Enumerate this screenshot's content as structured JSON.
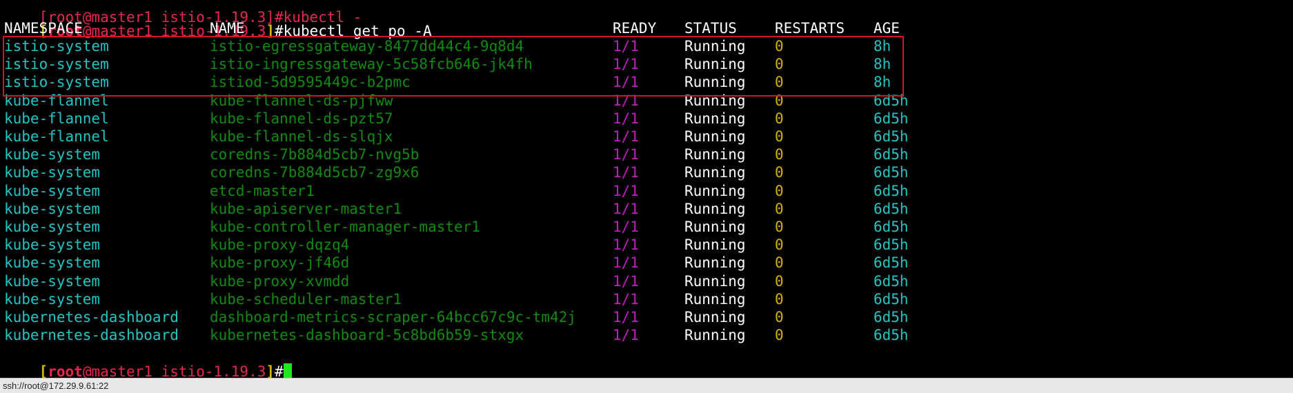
{
  "prompt": {
    "open_bracket": "[",
    "user": "root",
    "at": "@",
    "host": "master1",
    "dir": "istio-1.19.3",
    "close_bracket": "]",
    "hash": "#"
  },
  "top_partial_line": "[root@master1 istio-1.19.3]#kubectl -",
  "command": "kubectl get po -A",
  "table": {
    "headers": [
      "NAMESPACE",
      "NAME",
      "READY",
      "STATUS",
      "RESTARTS",
      "AGE"
    ],
    "rows": [
      [
        "istio-system",
        "istio-egressgateway-8477dd44c4-9q8d4",
        "1/1",
        "Running",
        "0",
        "8h"
      ],
      [
        "istio-system",
        "istio-ingressgateway-5c58fcb646-jk4fh",
        "1/1",
        "Running",
        "0",
        "8h"
      ],
      [
        "istio-system",
        "istiod-5d9595449c-b2pmc",
        "1/1",
        "Running",
        "0",
        "8h"
      ],
      [
        "kube-flannel",
        "kube-flannel-ds-pjfww",
        "1/1",
        "Running",
        "0",
        "6d5h"
      ],
      [
        "kube-flannel",
        "kube-flannel-ds-pzt57",
        "1/1",
        "Running",
        "0",
        "6d5h"
      ],
      [
        "kube-flannel",
        "kube-flannel-ds-slqjx",
        "1/1",
        "Running",
        "0",
        "6d5h"
      ],
      [
        "kube-system",
        "coredns-7b884d5cb7-nvg5b",
        "1/1",
        "Running",
        "0",
        "6d5h"
      ],
      [
        "kube-system",
        "coredns-7b884d5cb7-zg9x6",
        "1/1",
        "Running",
        "0",
        "6d5h"
      ],
      [
        "kube-system",
        "etcd-master1",
        "1/1",
        "Running",
        "0",
        "6d5h"
      ],
      [
        "kube-system",
        "kube-apiserver-master1",
        "1/1",
        "Running",
        "0",
        "6d5h"
      ],
      [
        "kube-system",
        "kube-controller-manager-master1",
        "1/1",
        "Running",
        "0",
        "6d5h"
      ],
      [
        "kube-system",
        "kube-proxy-dqzq4",
        "1/1",
        "Running",
        "0",
        "6d5h"
      ],
      [
        "kube-system",
        "kube-proxy-jf46d",
        "1/1",
        "Running",
        "0",
        "6d5h"
      ],
      [
        "kube-system",
        "kube-proxy-xvmdd",
        "1/1",
        "Running",
        "0",
        "6d5h"
      ],
      [
        "kube-system",
        "kube-scheduler-master1",
        "1/1",
        "Running",
        "0",
        "6d5h"
      ],
      [
        "kubernetes-dashboard",
        "dashboard-metrics-scraper-64bcc67c9c-tm42j",
        "1/1",
        "Running",
        "0",
        "6d5h"
      ],
      [
        "kubernetes-dashboard",
        "kubernetes-dashboard-5c8bd6b59-stxgx",
        "1/1",
        "Running",
        "0",
        "6d5h"
      ]
    ]
  },
  "statusbar": {
    "connection": "ssh://root@172.29.9.61:22"
  },
  "colors": {
    "background": "#000000",
    "namespace": "#22c4c4",
    "name": "#118a11",
    "ready": "#c21bc2",
    "restarts": "#d4b200",
    "age": "#22c4c4",
    "prompt_host": "#e8264e",
    "cursor": "#1ee81e",
    "highlight_box": "#d8141e"
  }
}
